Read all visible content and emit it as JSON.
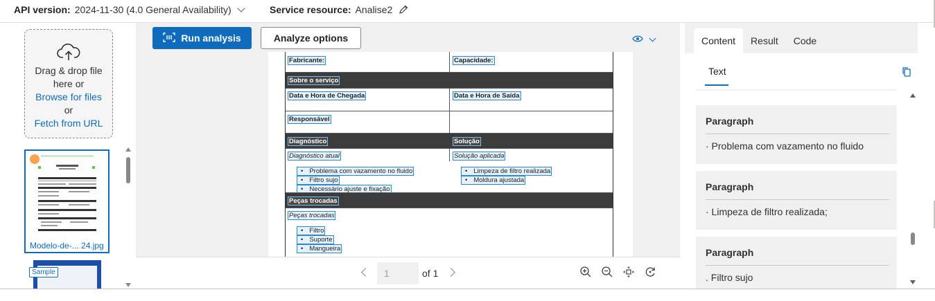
{
  "topbar": {
    "api_label": "API version:",
    "api_value": "2024-11-30 (4.0 General Availability)",
    "service_label": "Service resource:",
    "service_value": "Analise2"
  },
  "left": {
    "drop_line1": "Drag & drop file",
    "drop_line2": "here or",
    "browse": "Browse for files",
    "or": "or",
    "fetch": "Fetch from URL",
    "thumb_caption": "Modelo-de-... 24.jpg",
    "sample_tag": "Sample"
  },
  "toolbar": {
    "run_label": "Run analysis",
    "options_label": "Analyze options"
  },
  "document": {
    "fabricante": "Fabricante:",
    "capacidade": "Capacidade:",
    "sobre": "Sobre o serviço",
    "chegada": "Data e Hora de Chegada",
    "saida": "Data e Hora de Saída",
    "responsavel": "Responsável",
    "diagnostico": "Diagnóstico",
    "solucao": "Solução",
    "diag_atual": "Diagnóstico atual",
    "sol_aplicada": "Solução aplicada",
    "diag_items": [
      "Problema com vazamento no fluido",
      "Filtro sujo",
      "Necessário ajuste e fixação"
    ],
    "sol_items": [
      "Limpeza de filtro realizada",
      "Moldura ajustada"
    ],
    "pecas_header": "Peças trocadas",
    "pecas_sub": "Peças trocadas",
    "pecas_items": [
      "Filtro",
      "Suporte",
      "Mangueira"
    ]
  },
  "pager": {
    "page": "1",
    "of": "of 1"
  },
  "right": {
    "tabs": [
      "Content",
      "Result",
      "Code"
    ],
    "subtab": "Text",
    "cards": [
      {
        "title": "Paragraph",
        "value": "· Problema com vazamento no fluido"
      },
      {
        "title": "Paragraph",
        "value": "· Limpeza de filtro realizada;"
      },
      {
        "title": "Paragraph",
        "value": ". Filtro sujo"
      }
    ]
  },
  "colors": {
    "accent": "#0f6cbd",
    "dark_row": "#3c3c3c",
    "highlight": "#2b88d8"
  },
  "icons": [
    "chevron-down-icon",
    "pencil-icon",
    "cloud-upload-icon",
    "run-analysis-icon",
    "eye-icon",
    "zoom-in-icon",
    "zoom-out-icon",
    "fit-page-icon",
    "rotate-icon",
    "copy-icon"
  ]
}
